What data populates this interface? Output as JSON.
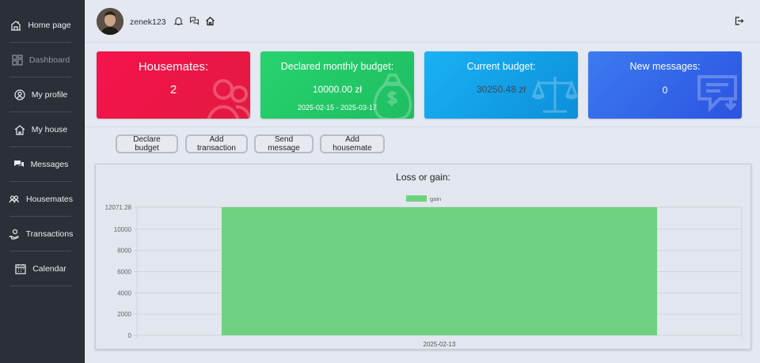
{
  "sidebar": {
    "items": [
      {
        "label": "Home page",
        "icon": "home-icon",
        "dim": false
      },
      {
        "label": "Dashboard",
        "icon": "dashboard-icon",
        "dim": true
      },
      {
        "label": "My profile",
        "icon": "user-circle-icon",
        "dim": false
      },
      {
        "label": "My house",
        "icon": "house-icon",
        "dim": false
      },
      {
        "label": "Messages",
        "icon": "chat-icon",
        "dim": false
      },
      {
        "label": "Housemates",
        "icon": "people-icon",
        "dim": false
      },
      {
        "label": "Transactions",
        "icon": "money-hand-icon",
        "dim": false
      },
      {
        "label": "Calendar",
        "icon": "calendar-icon",
        "dim": false
      }
    ]
  },
  "header": {
    "username": "zenek123",
    "icons": [
      "bell-icon",
      "chat-arrows-icon",
      "home-icon",
      "logout-icon"
    ]
  },
  "cards": {
    "housemates": {
      "title": "Housemates:",
      "value": "2"
    },
    "declared": {
      "title": "Declared monthly budget:",
      "value": "10000.00 zł",
      "range": "2025-02-15 - 2025-03-17"
    },
    "current": {
      "title": "Current budget:",
      "value": "30250.48 zł"
    },
    "messages": {
      "title": "New messages:",
      "value": "0"
    }
  },
  "buttons": {
    "declare_budget": "Declare budget",
    "add_transaction": "Add transaction",
    "send_message": "Send message",
    "add_housemate": "Add housemate"
  },
  "colors": {
    "housemates": "#f5134d",
    "declared": "#27d36f",
    "current": "#1ab1f5",
    "messages": "#3c7bf0",
    "bar": "#6fd17f"
  },
  "chart_data": {
    "type": "bar",
    "title": "Loss or gain:",
    "categories": [
      "2025-02-13"
    ],
    "series": [
      {
        "name": "gain",
        "values": [
          12071.28
        ]
      }
    ],
    "yticks": [
      "0",
      "2000",
      "4000",
      "6000",
      "8000",
      "10000",
      "12071.28"
    ],
    "ylim": [
      0,
      12071.28
    ],
    "grid": true,
    "legend": "top-center"
  }
}
